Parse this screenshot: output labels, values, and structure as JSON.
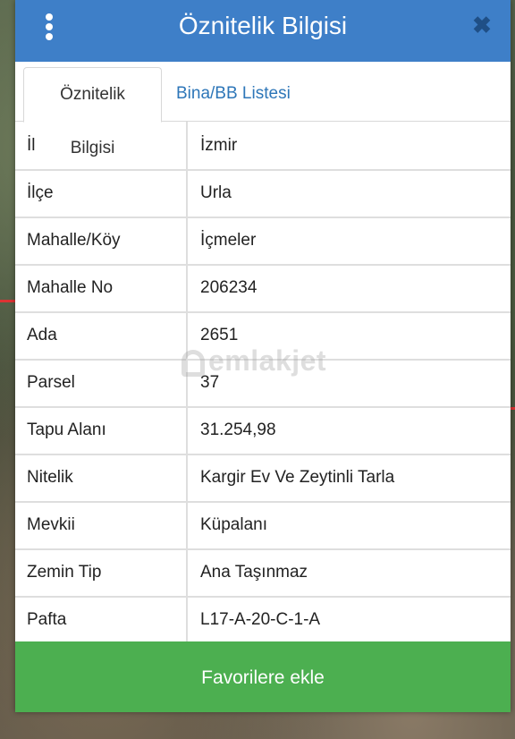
{
  "header": {
    "title": "Öznitelik Bilgisi",
    "menu_icon": "vertical-dots-icon",
    "close_icon": "close-icon",
    "colors": {
      "header_bg": "#3e7fc8",
      "close": "#1f4f86"
    }
  },
  "tabs": [
    {
      "label": "Öznitelik Bilgisi",
      "active": true
    },
    {
      "label": "Bina/BB Listesi",
      "active": false
    }
  ],
  "attributes": [
    {
      "key": "İl",
      "value": "İzmir"
    },
    {
      "key": "İlçe",
      "value": "Urla"
    },
    {
      "key": "Mahalle/Köy",
      "value": "İçmeler"
    },
    {
      "key": "Mahalle No",
      "value": "206234"
    },
    {
      "key": "Ada",
      "value": "2651"
    },
    {
      "key": "Parsel",
      "value": "37"
    },
    {
      "key": "Tapu Alanı",
      "value": "31.254,98"
    },
    {
      "key": "Nitelik",
      "value": "Kargir Ev Ve Zeytinli Tarla"
    },
    {
      "key": "Mevkii",
      "value": "Küpalanı"
    },
    {
      "key": "Zemin Tip",
      "value": "Ana Taşınmaz"
    },
    {
      "key": "Pafta",
      "value": "L17-A-20-C-1-A"
    }
  ],
  "watermark": "emlakjet",
  "footer": {
    "button_label": "Favorilere ekle",
    "button_color": "#4caf50"
  }
}
